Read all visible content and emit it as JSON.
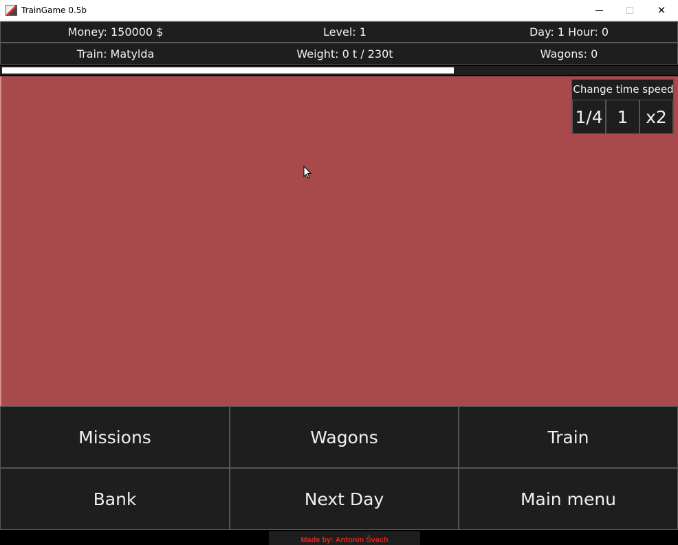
{
  "window": {
    "title": "TrainGame 0.5b",
    "controls": {
      "minimize": "—",
      "maximize": "☐",
      "close": "✕"
    }
  },
  "status": {
    "money": "Money: 150000 $",
    "level": "Level: 1",
    "time": "Day: 1 Hour: 0",
    "train": "Train: Matylda",
    "weight": "Weight: 0 t / 230t",
    "wagons": "Wagons: 0"
  },
  "progress": {
    "value_percent": 67
  },
  "map": {
    "background_color": "#a84a4b"
  },
  "speed_panel": {
    "title": "Change time speed",
    "options": [
      "1/4",
      "1",
      "x2"
    ]
  },
  "menu": {
    "row1": [
      "Missions",
      "Wagons",
      "Train"
    ],
    "row2": [
      "Bank",
      "Next Day",
      "Main menu"
    ]
  },
  "footer": {
    "credit": "Made by: Antonín Švach"
  },
  "colors": {
    "panel": "#1e1e1e",
    "text": "#f2f2f2",
    "credit": "#e02020"
  }
}
